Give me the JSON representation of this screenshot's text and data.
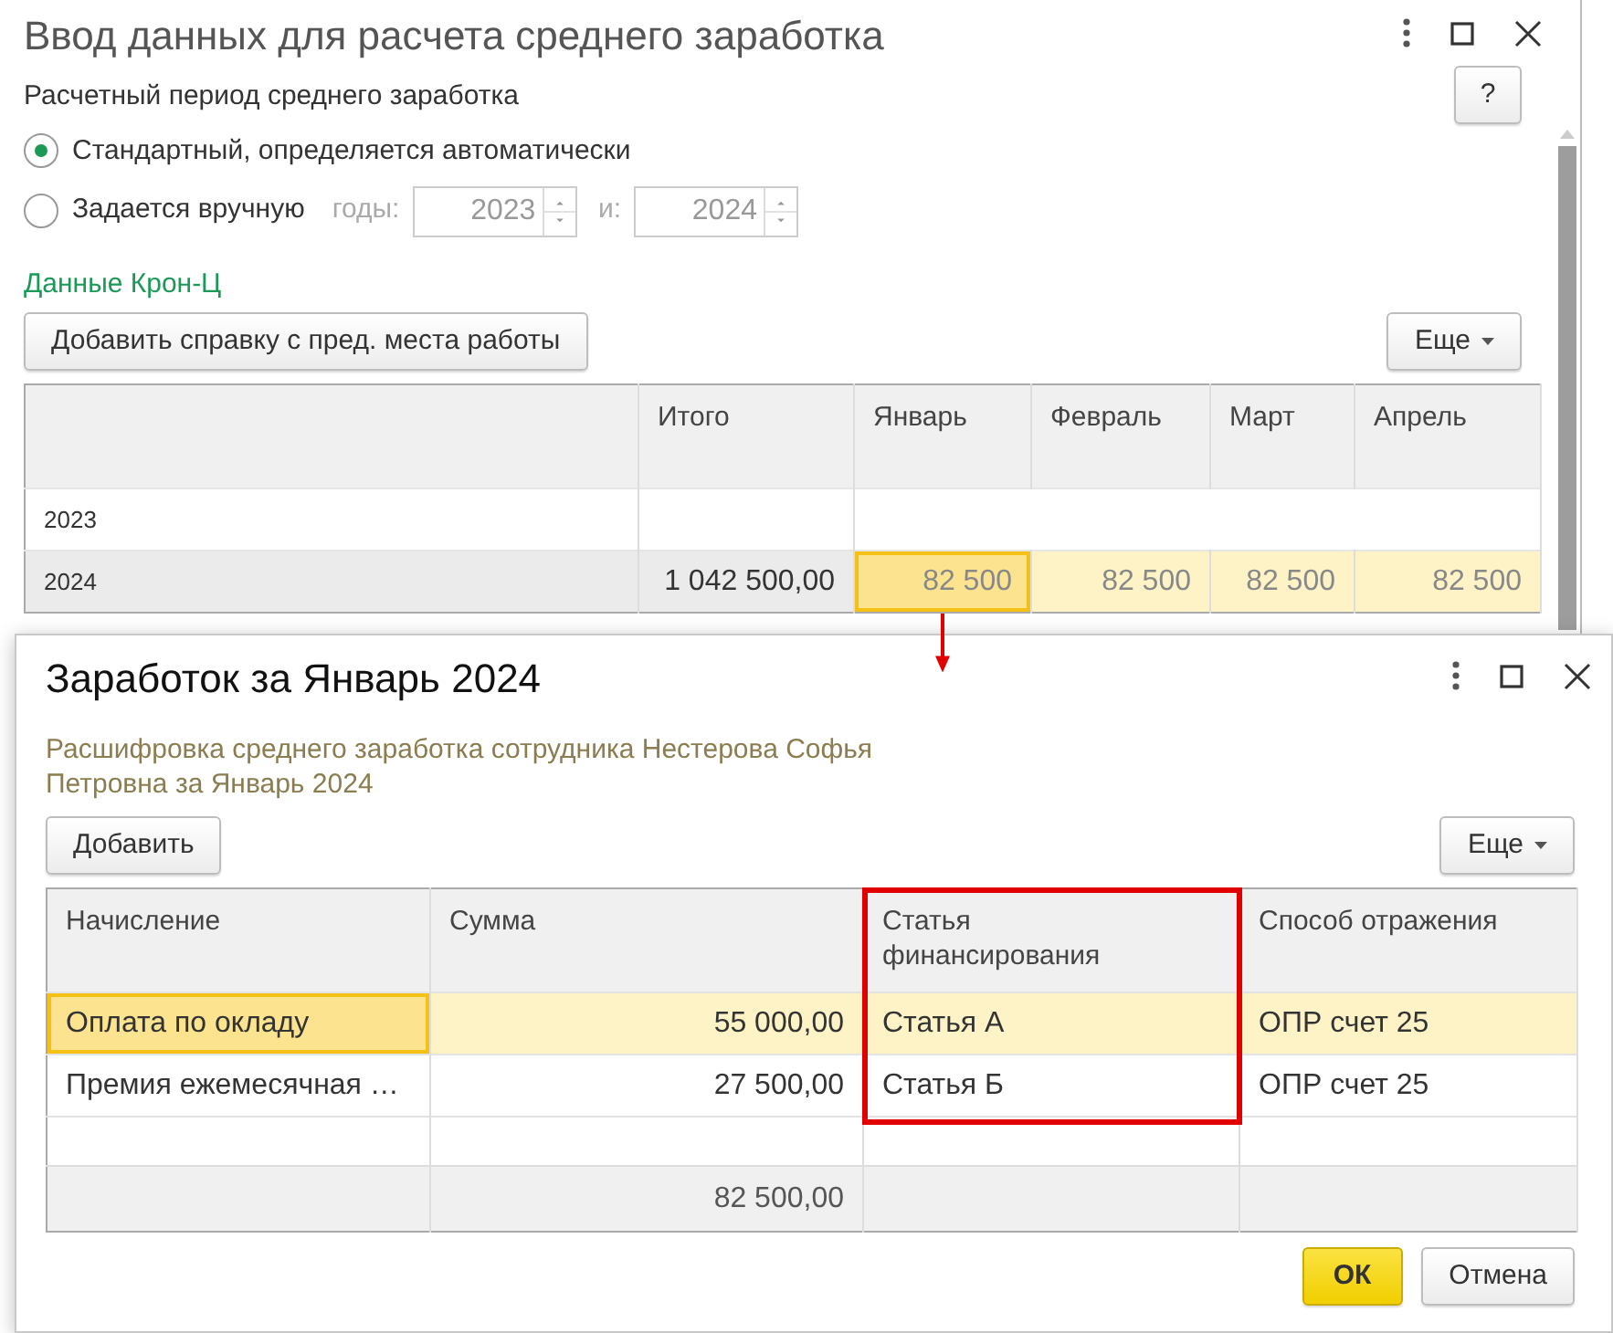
{
  "window": {
    "title": "Ввод данных для расчета среднего заработка"
  },
  "period": {
    "label": "Расчетный период среднего заработка",
    "help_button": "?",
    "options": [
      {
        "label": "Стандартный, определяется автоматически",
        "selected": true
      },
      {
        "label": "Задается вручную",
        "selected": false
      }
    ],
    "years_label": "годы:",
    "year_from": "2023",
    "to_label": "и:",
    "year_to": "2024"
  },
  "section_title": "Данные Крон-Ц",
  "toolbar": {
    "add_button": "Добавить справку с пред. места работы",
    "more_button": "Еще"
  },
  "table": {
    "columns": [
      "",
      "Итого",
      "Январь",
      "Февраль",
      "Март",
      "Апрель"
    ],
    "rows": [
      {
        "selected": false,
        "cells": [
          {
            "value": "2023"
          }
        ]
      },
      {
        "selected": true,
        "cells": [
          {
            "value": "2024"
          },
          {
            "value": "1 042 500,00"
          },
          {
            "value": "82 500",
            "selected": true
          },
          {
            "value": "82 500",
            "selected": false
          },
          {
            "value": "82 500",
            "selected": false
          },
          {
            "value": "82 500",
            "selected": false
          }
        ]
      }
    ]
  },
  "dialog": {
    "title": "Заработок за Январь 2024",
    "description": "Расшифровка среднего заработка сотрудника Нестерова Софья Петровна за Январь 2024",
    "add_button": "Добавить",
    "more_button": "Еще",
    "columns": [
      {
        "label": "Начисление",
        "highlighted": false
      },
      {
        "label": "Сумма",
        "highlighted": false
      },
      {
        "label": "Статья финансирования",
        "highlighted": true
      },
      {
        "label": "Способ отражения",
        "highlighted": false
      }
    ],
    "rows": [
      {
        "cells": [
          "Оплата по окладу",
          "55 000,00",
          "Статья А",
          "ОПР счет 25"
        ],
        "selected": true
      },
      {
        "cells": [
          "Премия ежемесячная …",
          "27 500,00",
          "Статья Б",
          "ОПР счет 25"
        ],
        "selected": false
      }
    ],
    "footer_total": "82 500,00",
    "ok_button": "ОК",
    "cancel_button": "Отмена"
  }
}
